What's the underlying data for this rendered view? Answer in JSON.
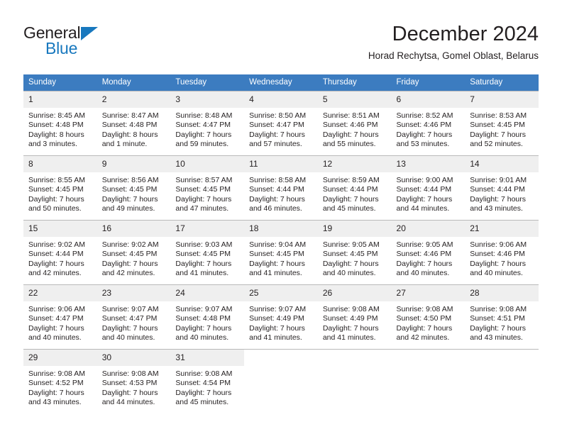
{
  "brand": {
    "name_part1": "General",
    "name_part2": "Blue",
    "accent_color": "#1878be"
  },
  "header": {
    "title": "December 2024",
    "subtitle": "Horad Rechytsa, Gomel Oblast, Belarus"
  },
  "calendar": {
    "header_bg": "#3c7cc0",
    "daynum_bg": "#efefef",
    "weekday_headers": [
      "Sunday",
      "Monday",
      "Tuesday",
      "Wednesday",
      "Thursday",
      "Friday",
      "Saturday"
    ],
    "weeks": [
      [
        {
          "day": "1",
          "sunrise": "Sunrise: 8:45 AM",
          "sunset": "Sunset: 4:48 PM",
          "daylight_line1": "Daylight: 8 hours",
          "daylight_line2": "and 3 minutes."
        },
        {
          "day": "2",
          "sunrise": "Sunrise: 8:47 AM",
          "sunset": "Sunset: 4:48 PM",
          "daylight_line1": "Daylight: 8 hours",
          "daylight_line2": "and 1 minute."
        },
        {
          "day": "3",
          "sunrise": "Sunrise: 8:48 AM",
          "sunset": "Sunset: 4:47 PM",
          "daylight_line1": "Daylight: 7 hours",
          "daylight_line2": "and 59 minutes."
        },
        {
          "day": "4",
          "sunrise": "Sunrise: 8:50 AM",
          "sunset": "Sunset: 4:47 PM",
          "daylight_line1": "Daylight: 7 hours",
          "daylight_line2": "and 57 minutes."
        },
        {
          "day": "5",
          "sunrise": "Sunrise: 8:51 AM",
          "sunset": "Sunset: 4:46 PM",
          "daylight_line1": "Daylight: 7 hours",
          "daylight_line2": "and 55 minutes."
        },
        {
          "day": "6",
          "sunrise": "Sunrise: 8:52 AM",
          "sunset": "Sunset: 4:46 PM",
          "daylight_line1": "Daylight: 7 hours",
          "daylight_line2": "and 53 minutes."
        },
        {
          "day": "7",
          "sunrise": "Sunrise: 8:53 AM",
          "sunset": "Sunset: 4:45 PM",
          "daylight_line1": "Daylight: 7 hours",
          "daylight_line2": "and 52 minutes."
        }
      ],
      [
        {
          "day": "8",
          "sunrise": "Sunrise: 8:55 AM",
          "sunset": "Sunset: 4:45 PM",
          "daylight_line1": "Daylight: 7 hours",
          "daylight_line2": "and 50 minutes."
        },
        {
          "day": "9",
          "sunrise": "Sunrise: 8:56 AM",
          "sunset": "Sunset: 4:45 PM",
          "daylight_line1": "Daylight: 7 hours",
          "daylight_line2": "and 49 minutes."
        },
        {
          "day": "10",
          "sunrise": "Sunrise: 8:57 AM",
          "sunset": "Sunset: 4:45 PM",
          "daylight_line1": "Daylight: 7 hours",
          "daylight_line2": "and 47 minutes."
        },
        {
          "day": "11",
          "sunrise": "Sunrise: 8:58 AM",
          "sunset": "Sunset: 4:44 PM",
          "daylight_line1": "Daylight: 7 hours",
          "daylight_line2": "and 46 minutes."
        },
        {
          "day": "12",
          "sunrise": "Sunrise: 8:59 AM",
          "sunset": "Sunset: 4:44 PM",
          "daylight_line1": "Daylight: 7 hours",
          "daylight_line2": "and 45 minutes."
        },
        {
          "day": "13",
          "sunrise": "Sunrise: 9:00 AM",
          "sunset": "Sunset: 4:44 PM",
          "daylight_line1": "Daylight: 7 hours",
          "daylight_line2": "and 44 minutes."
        },
        {
          "day": "14",
          "sunrise": "Sunrise: 9:01 AM",
          "sunset": "Sunset: 4:44 PM",
          "daylight_line1": "Daylight: 7 hours",
          "daylight_line2": "and 43 minutes."
        }
      ],
      [
        {
          "day": "15",
          "sunrise": "Sunrise: 9:02 AM",
          "sunset": "Sunset: 4:44 PM",
          "daylight_line1": "Daylight: 7 hours",
          "daylight_line2": "and 42 minutes."
        },
        {
          "day": "16",
          "sunrise": "Sunrise: 9:02 AM",
          "sunset": "Sunset: 4:45 PM",
          "daylight_line1": "Daylight: 7 hours",
          "daylight_line2": "and 42 minutes."
        },
        {
          "day": "17",
          "sunrise": "Sunrise: 9:03 AM",
          "sunset": "Sunset: 4:45 PM",
          "daylight_line1": "Daylight: 7 hours",
          "daylight_line2": "and 41 minutes."
        },
        {
          "day": "18",
          "sunrise": "Sunrise: 9:04 AM",
          "sunset": "Sunset: 4:45 PM",
          "daylight_line1": "Daylight: 7 hours",
          "daylight_line2": "and 41 minutes."
        },
        {
          "day": "19",
          "sunrise": "Sunrise: 9:05 AM",
          "sunset": "Sunset: 4:45 PM",
          "daylight_line1": "Daylight: 7 hours",
          "daylight_line2": "and 40 minutes."
        },
        {
          "day": "20",
          "sunrise": "Sunrise: 9:05 AM",
          "sunset": "Sunset: 4:46 PM",
          "daylight_line1": "Daylight: 7 hours",
          "daylight_line2": "and 40 minutes."
        },
        {
          "day": "21",
          "sunrise": "Sunrise: 9:06 AM",
          "sunset": "Sunset: 4:46 PM",
          "daylight_line1": "Daylight: 7 hours",
          "daylight_line2": "and 40 minutes."
        }
      ],
      [
        {
          "day": "22",
          "sunrise": "Sunrise: 9:06 AM",
          "sunset": "Sunset: 4:47 PM",
          "daylight_line1": "Daylight: 7 hours",
          "daylight_line2": "and 40 minutes."
        },
        {
          "day": "23",
          "sunrise": "Sunrise: 9:07 AM",
          "sunset": "Sunset: 4:47 PM",
          "daylight_line1": "Daylight: 7 hours",
          "daylight_line2": "and 40 minutes."
        },
        {
          "day": "24",
          "sunrise": "Sunrise: 9:07 AM",
          "sunset": "Sunset: 4:48 PM",
          "daylight_line1": "Daylight: 7 hours",
          "daylight_line2": "and 40 minutes."
        },
        {
          "day": "25",
          "sunrise": "Sunrise: 9:07 AM",
          "sunset": "Sunset: 4:49 PM",
          "daylight_line1": "Daylight: 7 hours",
          "daylight_line2": "and 41 minutes."
        },
        {
          "day": "26",
          "sunrise": "Sunrise: 9:08 AM",
          "sunset": "Sunset: 4:49 PM",
          "daylight_line1": "Daylight: 7 hours",
          "daylight_line2": "and 41 minutes."
        },
        {
          "day": "27",
          "sunrise": "Sunrise: 9:08 AM",
          "sunset": "Sunset: 4:50 PM",
          "daylight_line1": "Daylight: 7 hours",
          "daylight_line2": "and 42 minutes."
        },
        {
          "day": "28",
          "sunrise": "Sunrise: 9:08 AM",
          "sunset": "Sunset: 4:51 PM",
          "daylight_line1": "Daylight: 7 hours",
          "daylight_line2": "and 43 minutes."
        }
      ],
      [
        {
          "day": "29",
          "sunrise": "Sunrise: 9:08 AM",
          "sunset": "Sunset: 4:52 PM",
          "daylight_line1": "Daylight: 7 hours",
          "daylight_line2": "and 43 minutes."
        },
        {
          "day": "30",
          "sunrise": "Sunrise: 9:08 AM",
          "sunset": "Sunset: 4:53 PM",
          "daylight_line1": "Daylight: 7 hours",
          "daylight_line2": "and 44 minutes."
        },
        {
          "day": "31",
          "sunrise": "Sunrise: 9:08 AM",
          "sunset": "Sunset: 4:54 PM",
          "daylight_line1": "Daylight: 7 hours",
          "daylight_line2": "and 45 minutes."
        },
        {
          "day": "",
          "sunrise": "",
          "sunset": "",
          "daylight_line1": "",
          "daylight_line2": ""
        },
        {
          "day": "",
          "sunrise": "",
          "sunset": "",
          "daylight_line1": "",
          "daylight_line2": ""
        },
        {
          "day": "",
          "sunrise": "",
          "sunset": "",
          "daylight_line1": "",
          "daylight_line2": ""
        },
        {
          "day": "",
          "sunrise": "",
          "sunset": "",
          "daylight_line1": "",
          "daylight_line2": ""
        }
      ]
    ]
  }
}
